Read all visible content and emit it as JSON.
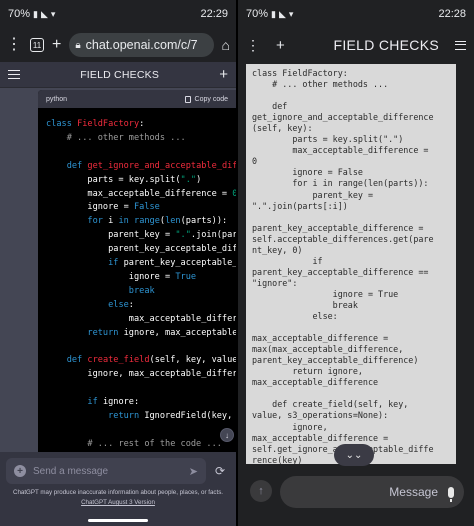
{
  "left": {
    "status": {
      "battery": "70%",
      "time": "22:29"
    },
    "browser": {
      "tab_count": "11",
      "url": "chat.openai.com/c/7"
    },
    "header": {
      "title": "FIELD CHECKS"
    },
    "code_block": {
      "language": "python",
      "copy_label": "Copy code"
    },
    "input": {
      "placeholder": "Send a message"
    },
    "disclaimer": "ChatGPT may produce inaccurate information about people, places, or facts.",
    "version_link": "ChatGPT August 3 Version"
  },
  "right": {
    "status": {
      "battery": "70%",
      "time": "22:28"
    },
    "header": {
      "title": "FIELD CHECKS"
    },
    "message_placeholder": "Message",
    "plain_text": "class FieldFactory:\n    # ... other methods ...\n\n    def\nget_ignore_and_acceptable_difference\n(self, key):\n        parts = key.split(\".\")\n        max_acceptable_difference =\n0\n        ignore = False\n        for i in range(len(parts)):\n            parent_key =\n\".\".join(parts[:i])\n\nparent_key_acceptable_difference =\nself.acceptable_differences.get(pare\nnt_key, 0)\n            if\nparent_key_acceptable_difference ==\n\"ignore\":\n                ignore = True\n                break\n            else:\n\nmax_acceptable_difference =\nmax(max_acceptable_difference,\nparent_key_acceptable_difference)\n        return ignore,\nmax_acceptable_difference\n\n    def create_field(self, key,\nvalue, s3_operations=None):\n        ignore,\nmax_acceptable_difference =\nself.get_ignore_and_acceptable_diffe\nrence(key)\n\n        if ignore:"
  },
  "colors": {
    "keyword": "#2e95d3",
    "function_name": "#f22c3d",
    "string": "#00a67d",
    "panel_dark": "#202123",
    "chat_bg": "#343541"
  },
  "icons": [
    "wifi-icon",
    "signal-icon",
    "home-icon",
    "lock-icon",
    "plus-icon",
    "menu-icon",
    "send-icon",
    "refresh-icon",
    "copy-icon",
    "mic-icon",
    "arrow-up-icon",
    "chevron-down-icon",
    "more-vert-icon"
  ]
}
